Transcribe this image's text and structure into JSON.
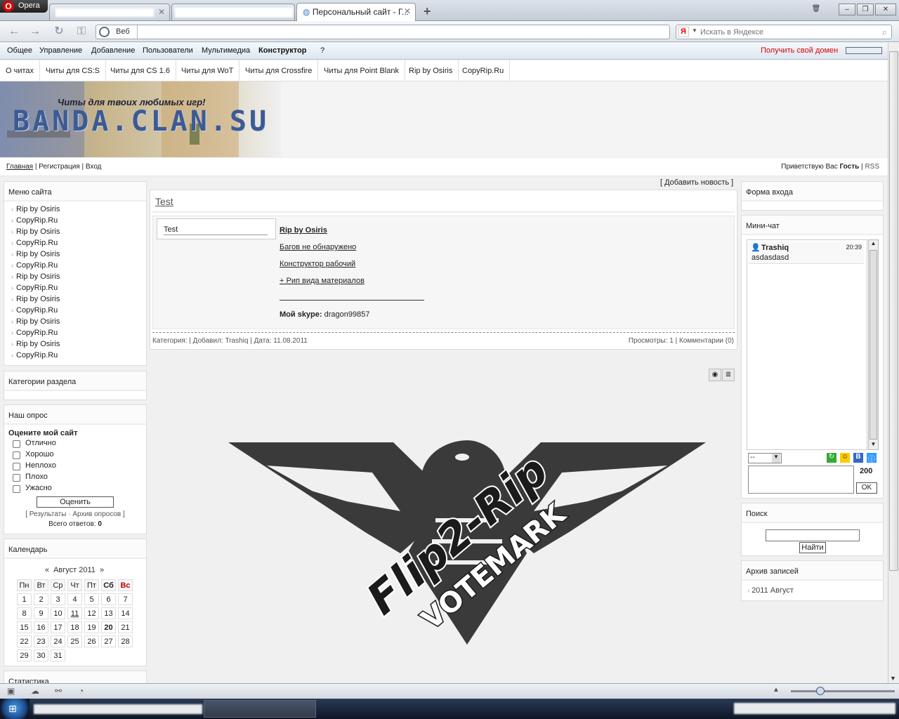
{
  "browser": {
    "menu_label": "Opera",
    "tabs": [
      {
        "label": ""
      },
      {
        "label": ""
      },
      {
        "label": "Персональный сайт - Г..."
      }
    ],
    "address": {
      "label": "Веб",
      "value": ""
    },
    "search": {
      "badge": "Я",
      "placeholder": "Искать в Яндексе"
    }
  },
  "ucoz_bar": {
    "items": [
      "Общее",
      "Управление",
      "Добавление",
      "Пользователи",
      "Мультимедиа",
      "Конструктор",
      "?"
    ],
    "bold_index": 5,
    "domain_link": "Получить свой домен"
  },
  "nav": {
    "items": [
      "О читах",
      "Читы для CS:S",
      "Читы для CS 1.6",
      "Читы для WoT",
      "Читы для Crossfire",
      "Читы для Point Blank",
      "Rip by Osiris",
      "CopyRip.Ru"
    ]
  },
  "banner": {
    "subtitle": "Читы для твоих любимых игр!",
    "logo": "BANDA.CLAN.SU"
  },
  "crumbs": {
    "home": "Главная",
    "sep": "|",
    "register": "Регистрация",
    "login": "Вход",
    "greeting": "Приветствую Вас",
    "user": "Гость",
    "rss": "RSS"
  },
  "left": {
    "menu_title": "Меню сайта",
    "menu_items": [
      "Rip by Osiris",
      "CopyRip.Ru",
      "Rip by Osiris",
      "CopyRip.Ru",
      "Rip by Osiris",
      "CopyRip.Ru",
      "Rip by Osiris",
      "CopyRip.Ru",
      "Rip by Osiris",
      "CopyRip.Ru",
      "Rip by Osiris",
      "CopyRip.Ru",
      "Rip by Osiris",
      "CopyRip.Ru"
    ],
    "categories_title": "Категории раздела",
    "poll": {
      "title": "Наш опрос",
      "question": "Оцените мой сайт",
      "options": [
        "Отлично",
        "Хорошо",
        "Неплохо",
        "Плохо",
        "Ужасно"
      ],
      "vote_button": "Оценить",
      "results_link": "Результаты",
      "archive_link": "Архив опросов",
      "total_label": "Всего ответов:",
      "total": "0"
    },
    "calendar": {
      "title": "Календарь",
      "prev": "«",
      "month": "Август 2011",
      "next": "»",
      "days": [
        "Пн",
        "Вт",
        "Ср",
        "Чт",
        "Пт",
        "Сб",
        "Вс"
      ],
      "weeks": [
        [
          "1",
          "2",
          "3",
          "4",
          "5",
          "6",
          "7"
        ],
        [
          "8",
          "9",
          "10",
          "11",
          "12",
          "13",
          "14"
        ],
        [
          "15",
          "16",
          "17",
          "18",
          "19",
          "20",
          "21"
        ],
        [
          "22",
          "23",
          "24",
          "25",
          "26",
          "27",
          "28"
        ],
        [
          "29",
          "30",
          "31",
          "",
          "",
          "",
          ""
        ]
      ],
      "highlight_color": "#c00000"
    },
    "stats_title": "Статистика"
  },
  "main": {
    "add_news": "[ Добавить новость ]",
    "title": "Test",
    "thumb_text": "Test",
    "lines": [
      "Rip by Osiris",
      "Багов не обнаружено",
      "Конструктор рабочий",
      "+ Рип вида материалов"
    ],
    "skype_label": "Мой skype:",
    "skype_value": "dragon99857",
    "footer_left": "Категория: | Добавил: Trashiq | Дата: 11.08.2011",
    "footer_right": "Просмотры: 1 | Комментарии (0)"
  },
  "emblem": {
    "line1": "Flip2-Rip",
    "line2": "VOTEMARK",
    "color": "#3a3a3a"
  },
  "right": {
    "login_title": "Форма входа",
    "chat_title": "Мини-чат",
    "chat_messages": [
      {
        "user": "Trashiq",
        "time": "20:39",
        "text": "asdasdasd"
      }
    ],
    "chat_select": "--",
    "chat_counter": "200",
    "chat_ok": "OK",
    "search_title": "Поиск",
    "search_button": "Найти",
    "archive_title": "Архив записей",
    "archive_items": [
      "2011 Август"
    ]
  },
  "colors": {
    "link_red": "#dd0000",
    "accent_blue": "#3c5b93"
  }
}
